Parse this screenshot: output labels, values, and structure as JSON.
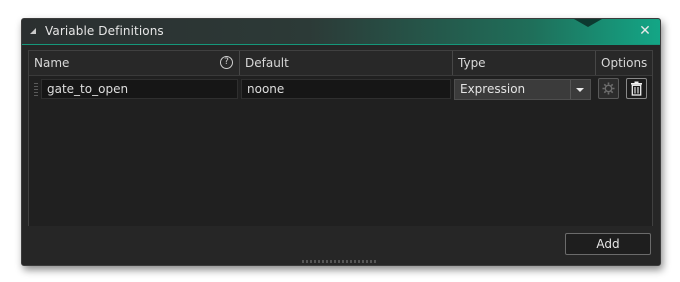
{
  "window": {
    "title": "Variable Definitions"
  },
  "table": {
    "columns": {
      "name": "Name",
      "default": "Default",
      "type": "Type",
      "options": "Options"
    },
    "rows": [
      {
        "name": "gate_to_open",
        "default": "noone",
        "type": "Expression"
      }
    ]
  },
  "footer": {
    "add_label": "Add"
  },
  "icons": {
    "collapse": "collapse-triangle-icon",
    "close": "close-icon",
    "help": "help-circle-icon",
    "drag": "drag-handle-icon",
    "dropdown": "chevron-down-icon",
    "settings": "gear-icon",
    "delete": "trash-icon"
  },
  "colors": {
    "accent": "#13a686",
    "window_bg": "#262626",
    "panel_bg": "#202020"
  }
}
